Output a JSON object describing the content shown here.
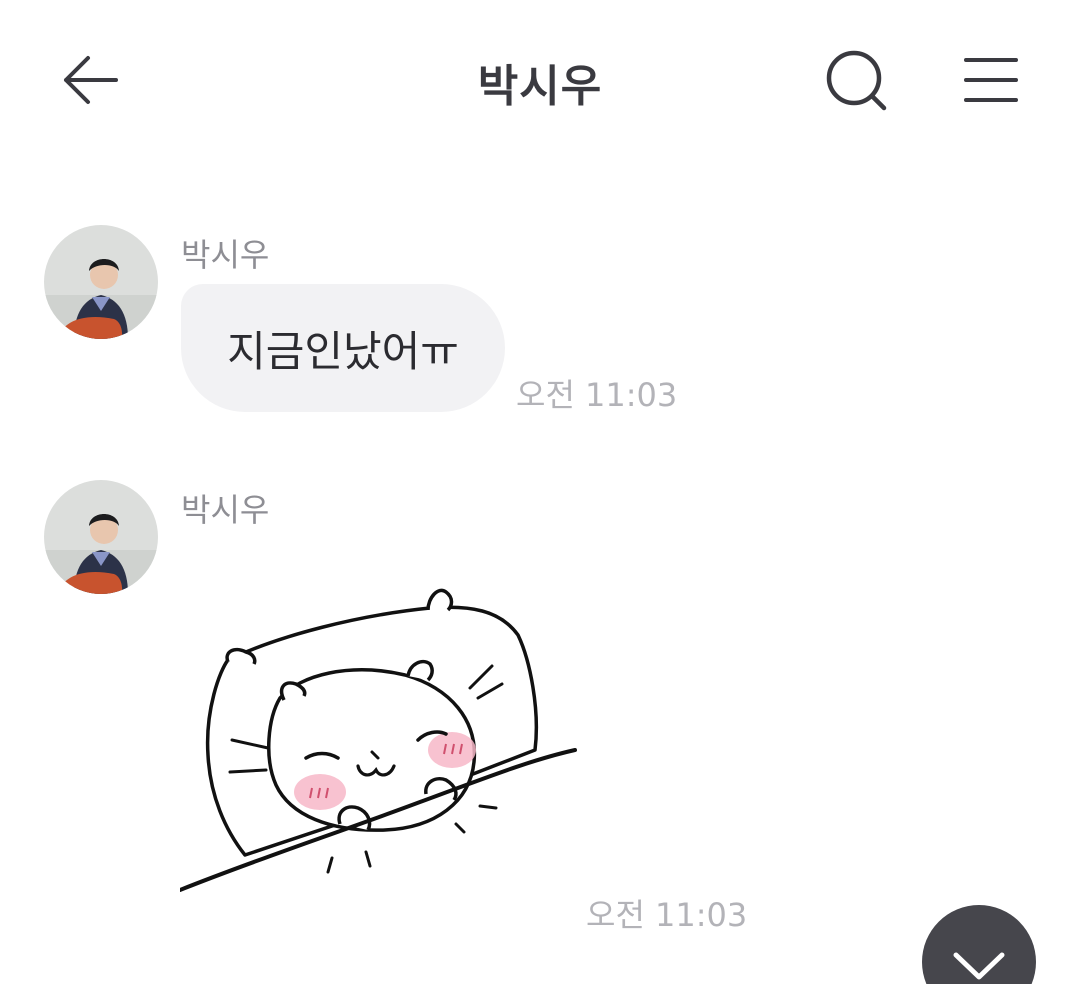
{
  "header": {
    "title": "박시우",
    "back_icon": "arrow-left-icon",
    "search_icon": "search-icon",
    "menu_icon": "hamburger-menu-icon"
  },
  "messages": [
    {
      "sender": "박시우",
      "type": "text",
      "text": "지금인났어ㅠ",
      "time": "오전 11:03"
    },
    {
      "sender": "박시우",
      "type": "sticker",
      "sticker": "sleeping-cat-sticker",
      "time": "오전 11:03"
    }
  ],
  "scroll_button_icon": "chevron-down-icon",
  "colors": {
    "bubble": "#f2f2f4",
    "text": "#333338",
    "muted": "#8e8e94",
    "timestamp": "#b3b3b8",
    "fab": "#46464c"
  }
}
